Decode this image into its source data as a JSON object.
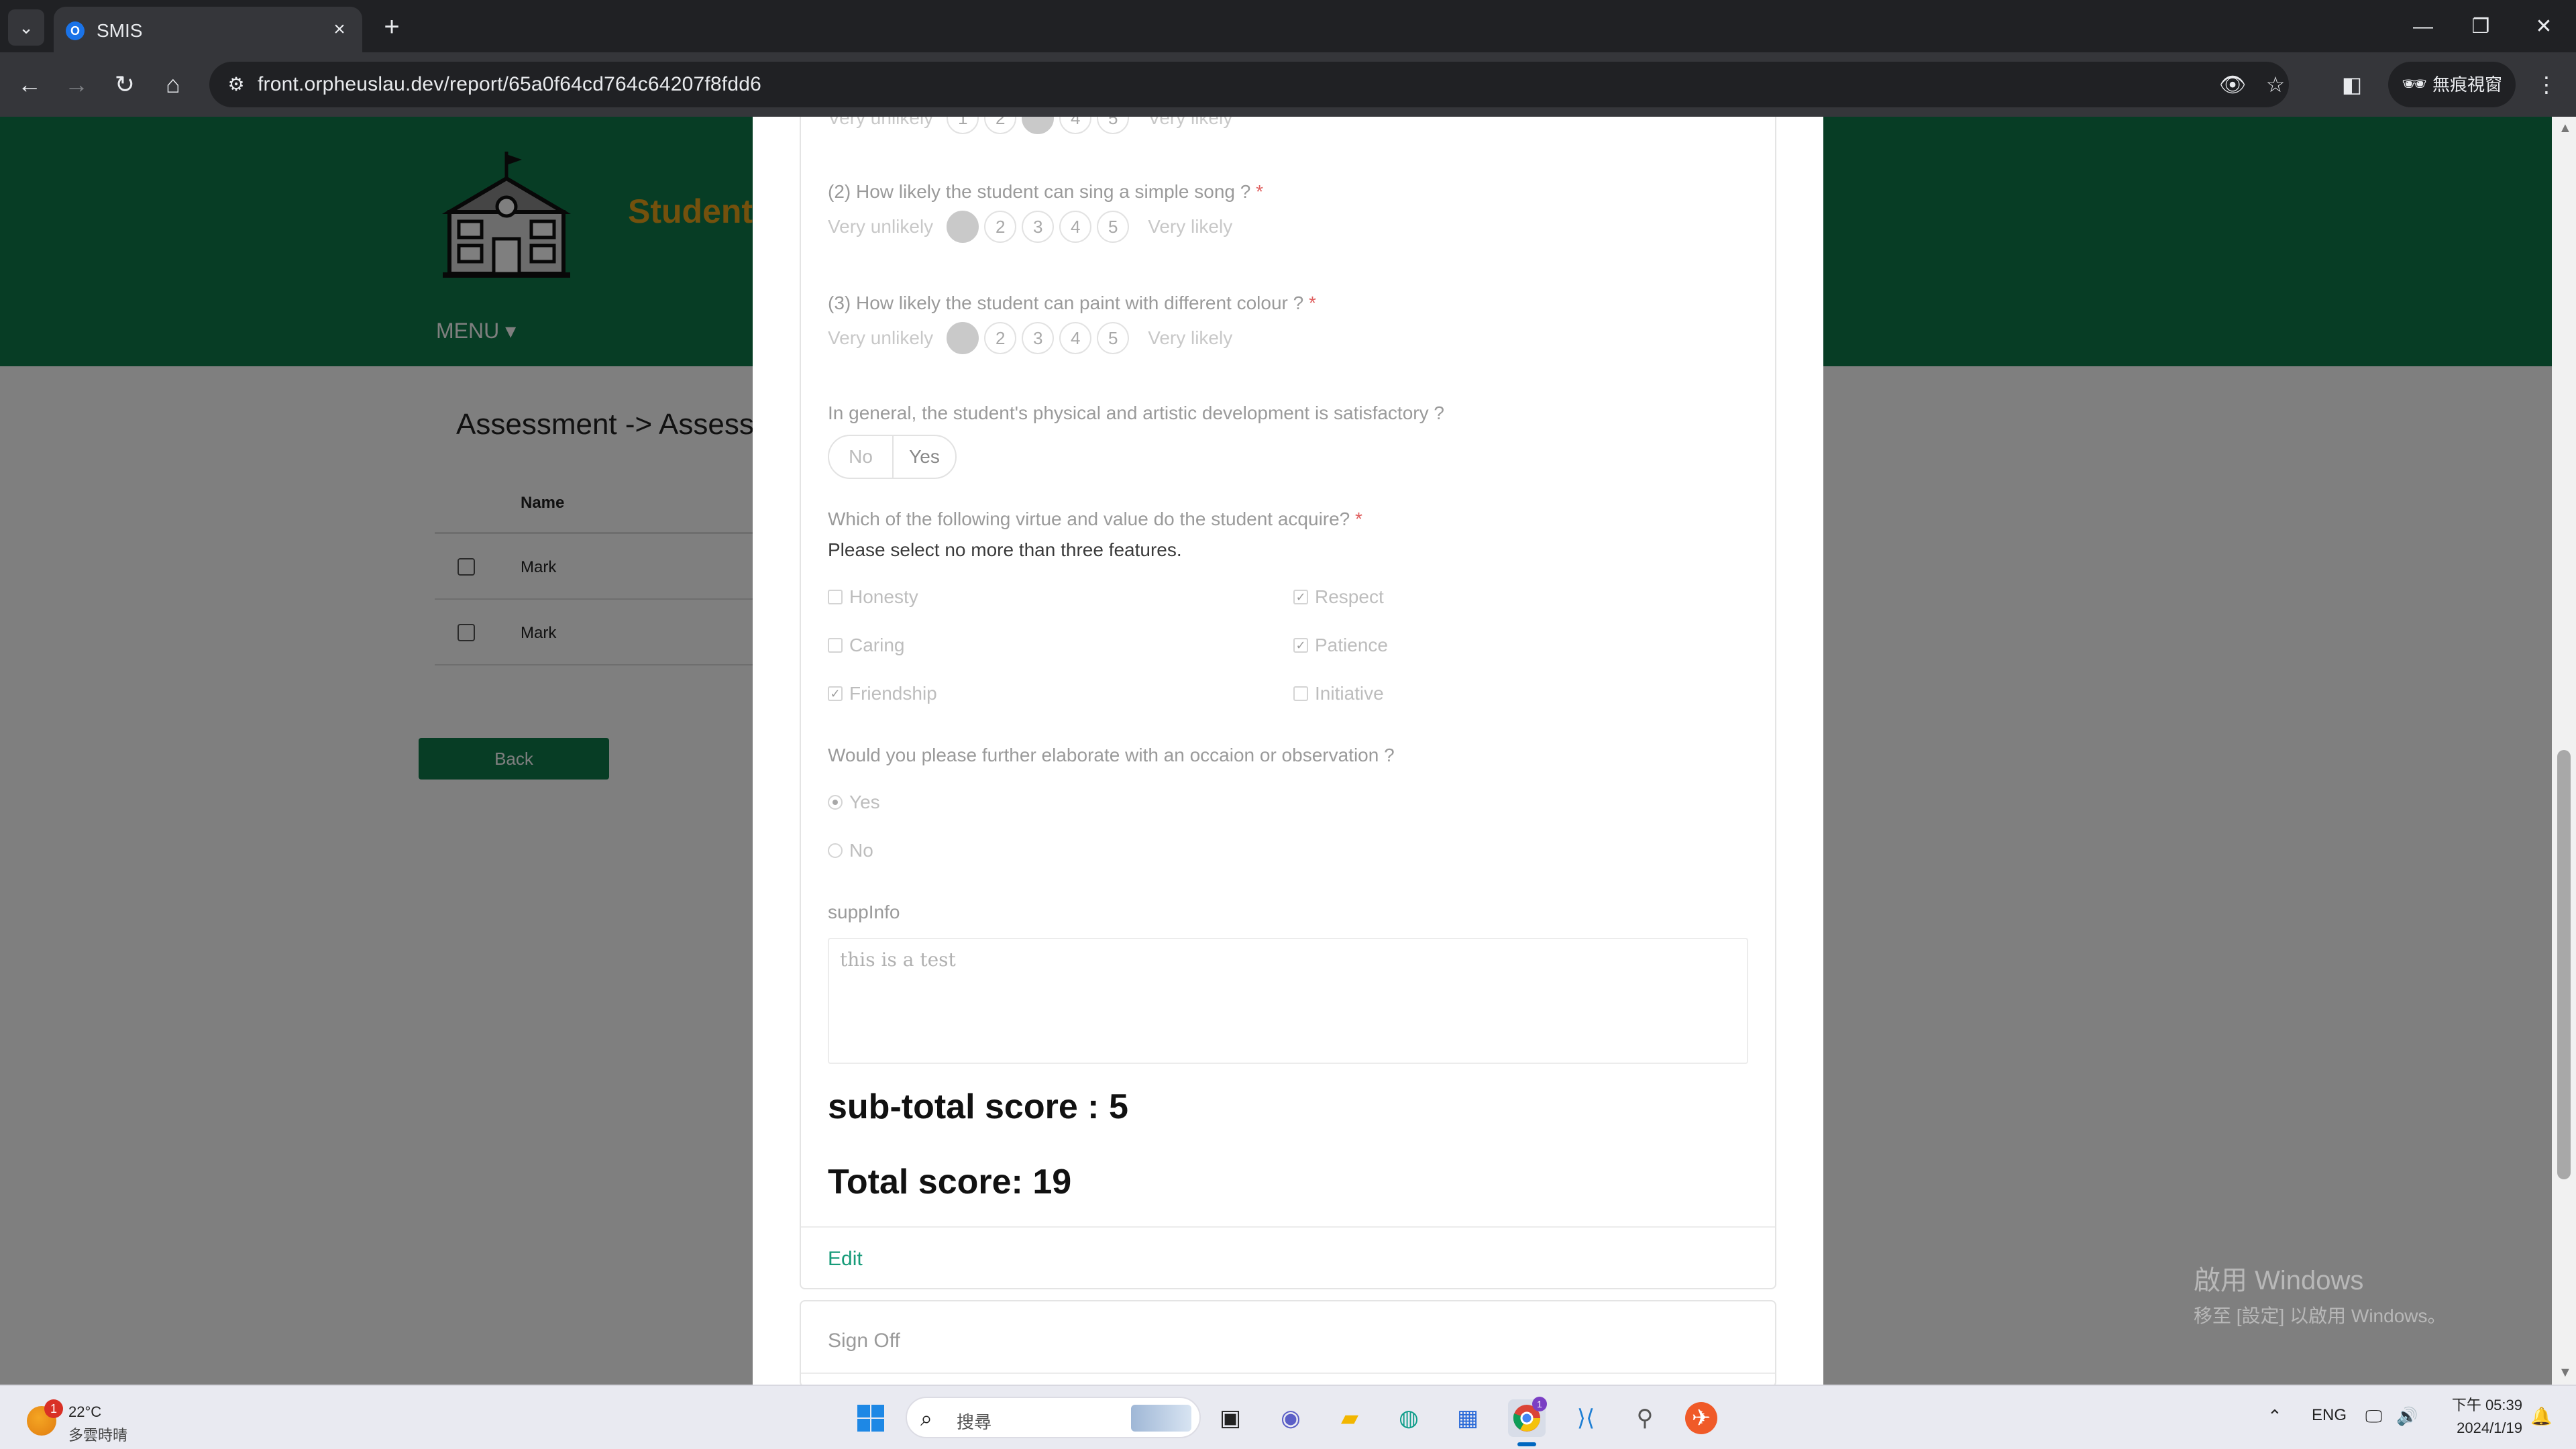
{
  "browser": {
    "tab_title": "SMIS",
    "tab_favicon_letter": "O",
    "url": "front.orpheuslau.dev/report/65a0f64cd764c64207f8fdd6",
    "incognito_label": "無痕視窗"
  },
  "app": {
    "brand": "Student",
    "menu_label": "MENU",
    "breadcrumb": "Assessment -> Assessm",
    "table": {
      "header": "Name",
      "rows": [
        {
          "name": "Mark"
        },
        {
          "name": "Mark"
        }
      ]
    },
    "back_label": "Back"
  },
  "modal": {
    "rating_low_label": "Very unlikely",
    "rating_high_label": "Very likely",
    "rating_options": [
      "1",
      "2",
      "3",
      "4",
      "5"
    ],
    "rating_rows": [
      {
        "question": "",
        "selected": 3
      },
      {
        "question": "(2) How likely the student can sing a simple song ?",
        "selected": 1
      },
      {
        "question": "(3) How likely the student can paint with different colour ?",
        "selected": 1
      }
    ],
    "required_mark": "*",
    "general_question": "In general, the student's physical and artistic development is satisfactory ?",
    "toggle": {
      "no": "No",
      "yes": "Yes",
      "selected": "Yes"
    },
    "virtue_question": "Which of the following virtue and value do the student acquire?",
    "virtue_hint": "Please select no more than three features.",
    "virtues": [
      {
        "label": "Honesty",
        "checked": false
      },
      {
        "label": "Respect",
        "checked": true
      },
      {
        "label": "Caring",
        "checked": false
      },
      {
        "label": "Patience",
        "checked": true
      },
      {
        "label": "Friendship",
        "checked": true
      },
      {
        "label": "Initiative",
        "checked": false
      }
    ],
    "elaborate_question": "Would you please further elaborate with an occaion or observation ?",
    "elaborate_options": [
      {
        "label": "Yes",
        "selected": true
      },
      {
        "label": "No",
        "selected": false
      }
    ],
    "supp_label": "suppInfo",
    "supp_value": "this is a test",
    "subtotal": "sub-total score : 5",
    "total": "Total score: 19",
    "edit_label": "Edit",
    "signoff_label": "Sign Off"
  },
  "watermark": {
    "line1": "啟用 Windows",
    "line2": "移至 [設定] 以啟用 Windows。"
  },
  "taskbar": {
    "weather_badge": "1",
    "temperature": "22°C",
    "condition": "多雲時晴",
    "search_placeholder": "搜尋",
    "language": "ENG",
    "time": "下午 05:39",
    "date": "2024/1/19",
    "chrome_badge": "1"
  }
}
